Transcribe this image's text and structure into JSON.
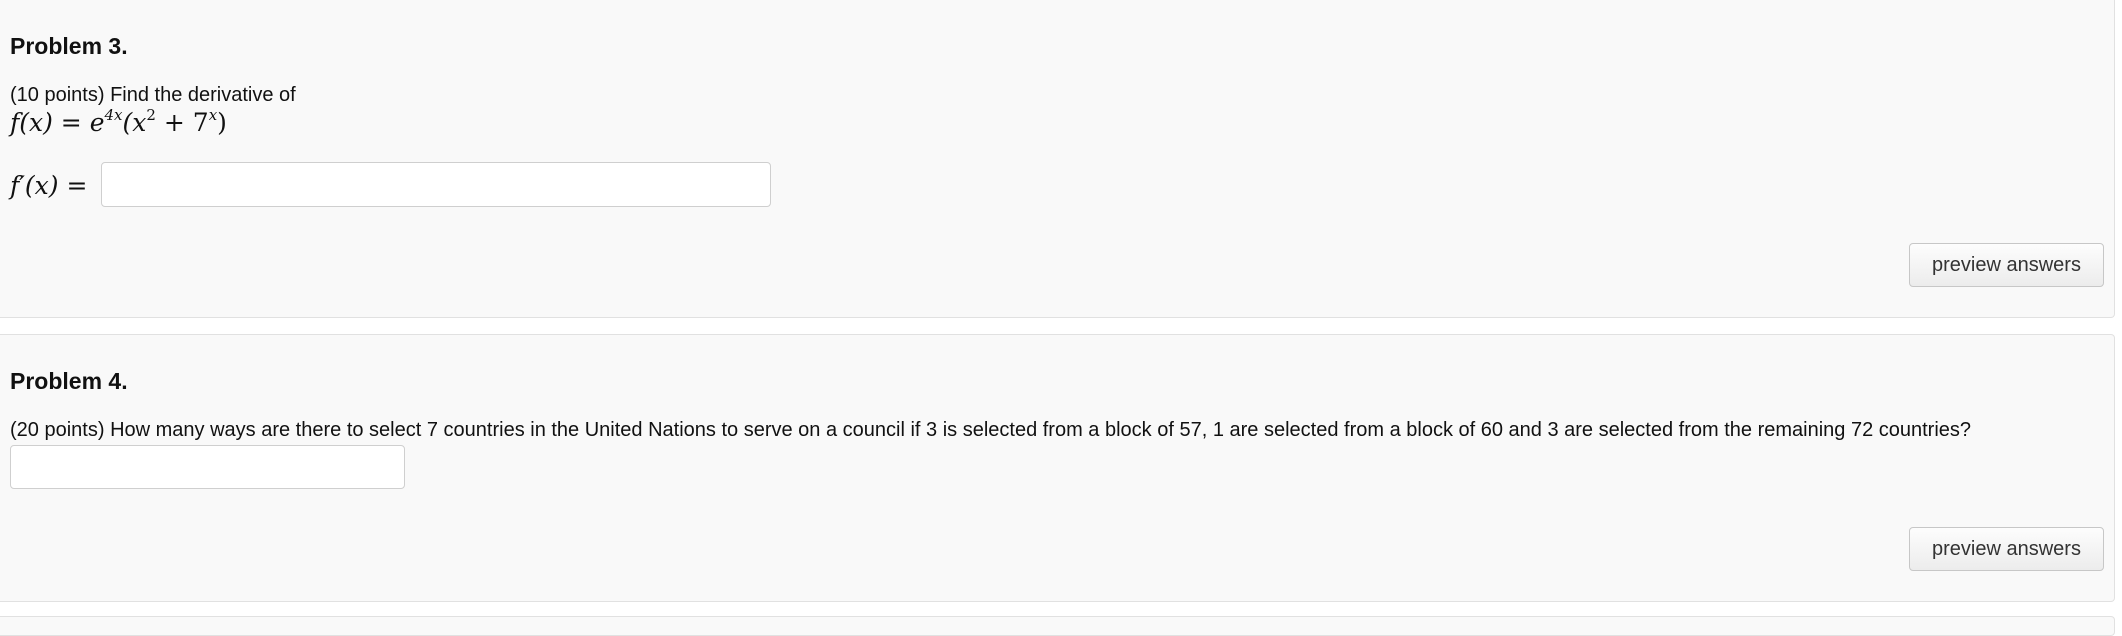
{
  "problems": [
    {
      "title": "Problem 3.",
      "points": "(10 points)",
      "prompt": "Find the derivative of",
      "function_lhs": "f(x) =",
      "base": "e",
      "base_exp": "4x",
      "paren_open": "(x",
      "x_exp": "2",
      "plus": "+ 7",
      "seven_exp": "x",
      "paren_close": ")",
      "answer_label": "f′(x) =",
      "answer_value": "",
      "button_label": "preview answers"
    },
    {
      "title": "Problem 4.",
      "points": "(20 points)",
      "prompt": "How many ways are there to select 7 countries in the United Nations to serve on a council if 3 is selected from a block of 57, 1 are selected from a block of 60 and 3 are selected from the remaining 72 countries?",
      "answer_value": "",
      "button_label": "preview answers"
    }
  ]
}
